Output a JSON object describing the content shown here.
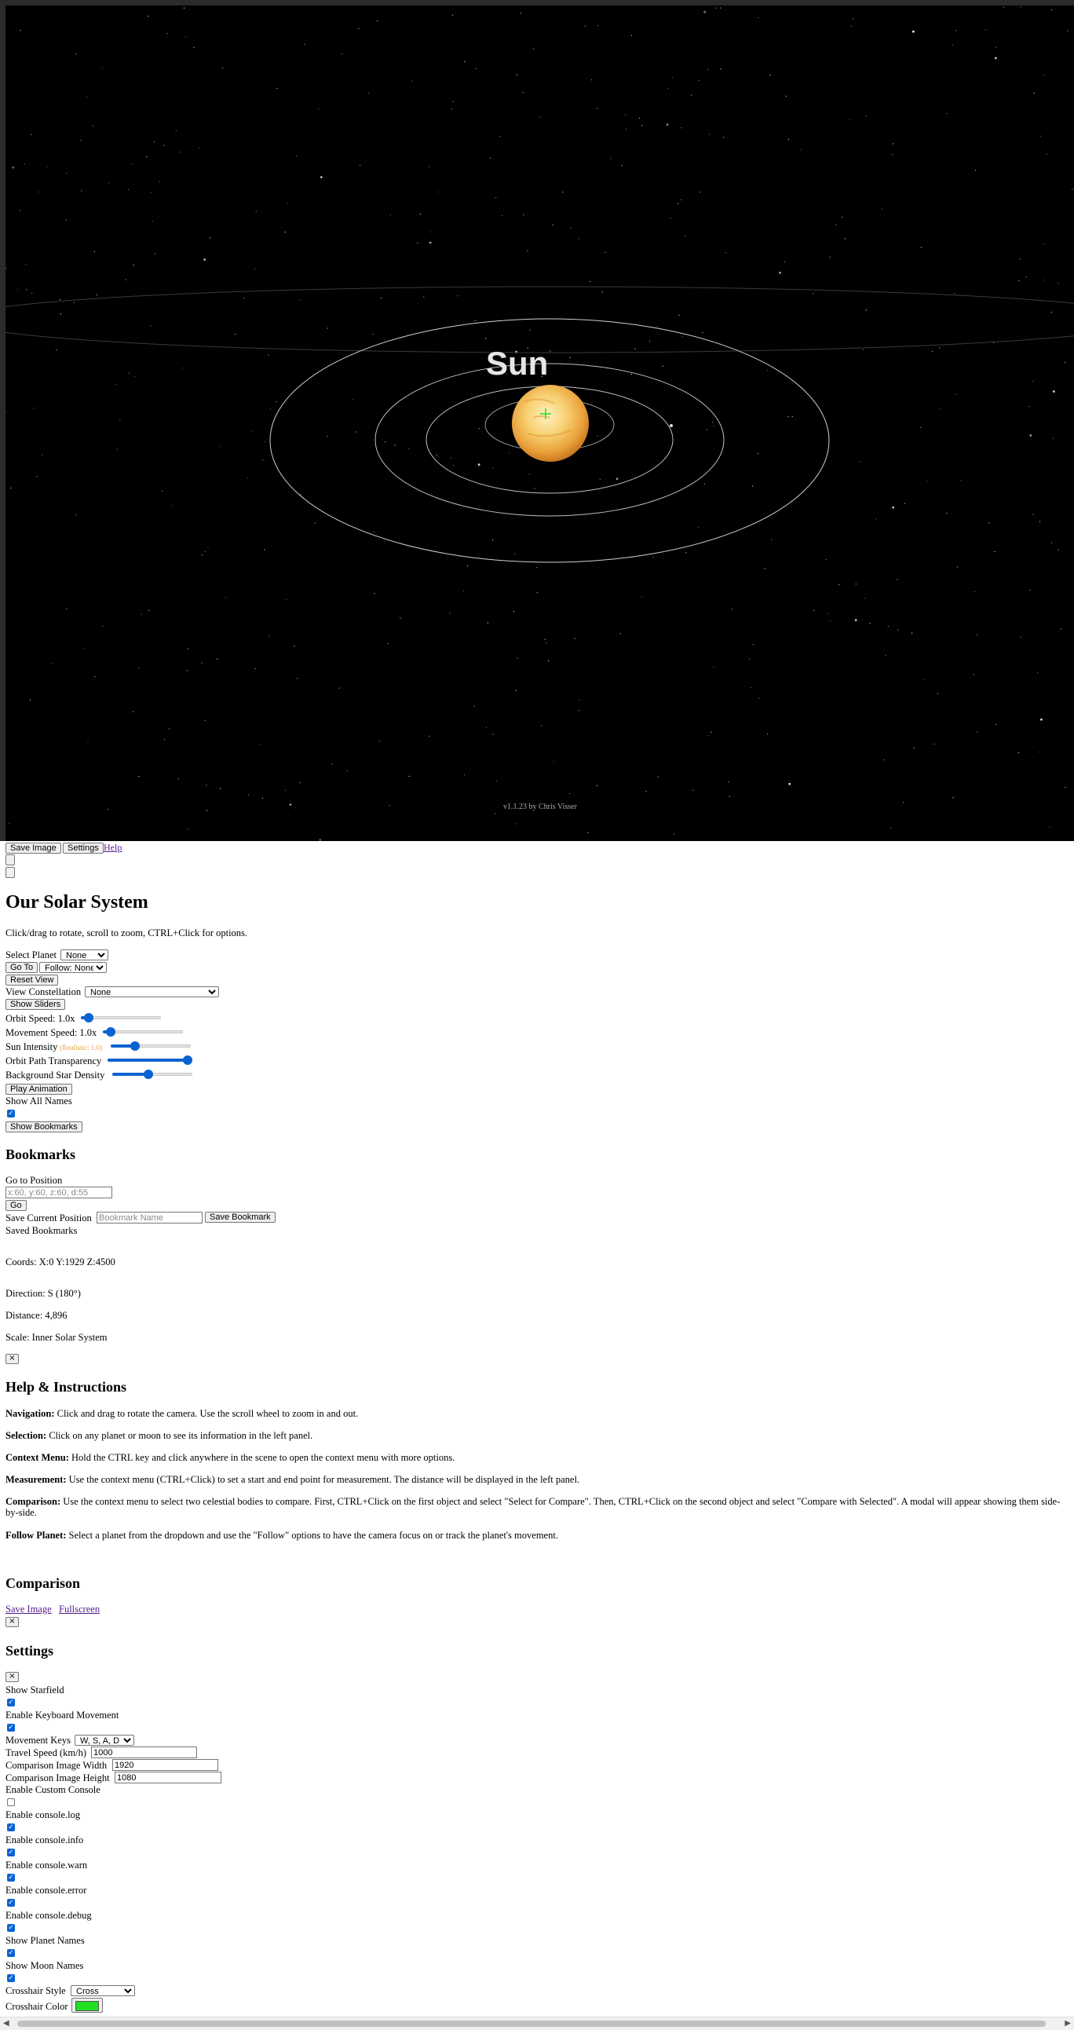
{
  "scene": {
    "sun_label": "Sun",
    "version": "v1.1.23 by Chris Visser"
  },
  "toolbar": {
    "save_image": "Save Image",
    "settings": "Settings",
    "help": "Help"
  },
  "panel": {
    "title": "Our Solar System",
    "subtitle": "Click/drag to rotate, scroll to zoom, CTRL+Click for options.",
    "select_planet_label": "Select Planet",
    "select_planet_value": "None",
    "go_to": "Go To",
    "follow_value": "Follow: None",
    "reset_view": "Reset View",
    "view_constellation_label": "View Constellation",
    "view_constellation_value": "None",
    "show_sliders": "Show Sliders",
    "orbit_speed_label": "Orbit Speed: 1.0x",
    "orbit_speed_level": 0.1,
    "movement_speed_label": "Movement Speed: 1.0x",
    "movement_speed_level": 0.1,
    "sun_intensity_label": "Sun Intensity",
    "sun_intensity_note": "(Realistic: 1.0)",
    "sun_intensity_level": 0.3,
    "orbit_path_label": "Orbit Path Transparency",
    "orbit_path_level": 1.0,
    "star_density_label": "Background Star Density",
    "star_density_level": 0.45,
    "play_animation": "Play Animation",
    "show_all_names_label": "Show All Names",
    "show_all_names_checked": true,
    "show_bookmarks": "Show Bookmarks"
  },
  "bookmarks": {
    "title": "Bookmarks",
    "go_to_position_label": "Go to Position",
    "position_placeholder": "x:60, y:60, z:60, d:55",
    "go": "Go",
    "save_current_label": "Save Current Position",
    "bookmark_name_placeholder": "Bookmark Name",
    "save_bookmark": "Save Bookmark",
    "saved_label": "Saved Bookmarks"
  },
  "status": {
    "coords": "Coords: X:0 Y:1929 Z:4500",
    "direction": "Direction: S (180°)",
    "distance": "Distance: 4,896",
    "scale": "Scale: Inner Solar System"
  },
  "help": {
    "close": "×",
    "title": "Help & Instructions",
    "items": [
      {
        "label": "Navigation:",
        "text": " Click and drag to rotate the camera. Use the scroll wheel to zoom in and out."
      },
      {
        "label": "Selection:",
        "text": " Click on any planet or moon to see its information in the left panel."
      },
      {
        "label": "Context Menu:",
        "text": " Hold the CTRL key and click anywhere in the scene to open the context menu with more options."
      },
      {
        "label": "Measurement:",
        "text": " Use the context menu (CTRL+Click) to set a start and end point for measurement. The distance will be displayed in the left panel."
      },
      {
        "label": "Comparison:",
        "text": " Use the context menu to select two celestial bodies to compare. First, CTRL+Click on the first object and select \"Select for Compare\". Then, CTRL+Click on the second object and select \"Compare with Selected\". A modal will appear showing them side-by-side."
      },
      {
        "label": "Follow Planet:",
        "text": " Select a planet from the dropdown and use the \"Follow\" options to have the camera focus on or track the planet's movement."
      }
    ]
  },
  "comparison": {
    "title": "Comparison",
    "save_image": "Save Image",
    "fullscreen": "Fullscreen",
    "close": "×"
  },
  "settings": {
    "title": "Settings",
    "close": "×",
    "show_starfield": "Show Starfield",
    "enable_keyboard": "Enable Keyboard Movement",
    "movement_keys_label": "Movement Keys",
    "movement_keys_value": "W, S, A, D",
    "travel_speed_label": "Travel Speed (km/h)",
    "travel_speed_value": "1000",
    "comp_width_label": "Comparison Image Width",
    "comp_width_value": "1920",
    "comp_height_label": "Comparison Image Height",
    "comp_height_value": "1080",
    "custom_console": "Enable Custom Console",
    "console_log": "Enable console.log",
    "console_info": "Enable console.info",
    "console_warn": "Enable console.warn",
    "console_error": "Enable console.error",
    "console_debug": "Enable console.debug",
    "show_planet_names": "Show Planet Names",
    "show_moon_names": "Show Moon Names",
    "crosshair_style_label": "Crosshair Style",
    "crosshair_style_value": "Cross",
    "crosshair_color_label": "Crosshair Color",
    "crosshair_color": "#22dd22"
  }
}
